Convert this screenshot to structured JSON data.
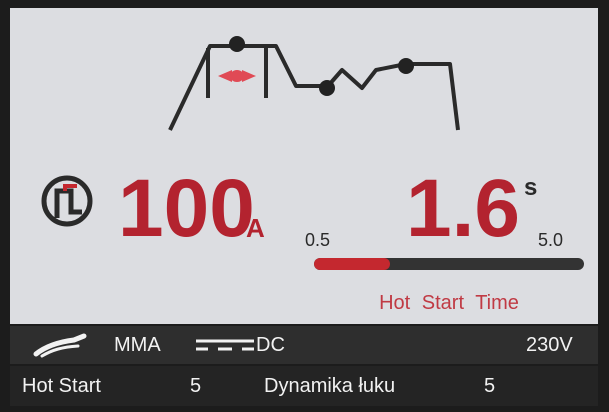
{
  "display": {
    "current_value": "100",
    "current_unit": "A",
    "time_value": "1.6",
    "time_unit": "s",
    "scale_min": "0.5",
    "scale_max": "5.0",
    "hot_start_fraction": 0.28,
    "parameter_label": "Hot Start Time"
  },
  "status_bar": {
    "mode": "MMA",
    "polarity": "DC",
    "voltage": "230V"
  },
  "parameters": {
    "hot_start_label": "Hot Start",
    "hot_start_value": "5",
    "arc_force_label": "Dynamika łuku",
    "arc_force_value": "5"
  },
  "colors": {
    "accent_red": "#b3232f",
    "screen_bg": "#dcdde1",
    "bar_bg": "#2e2e2e"
  },
  "icons": [
    "pulse-mode-icon",
    "electrode-holder-icon",
    "dc-symbol-icon"
  ]
}
